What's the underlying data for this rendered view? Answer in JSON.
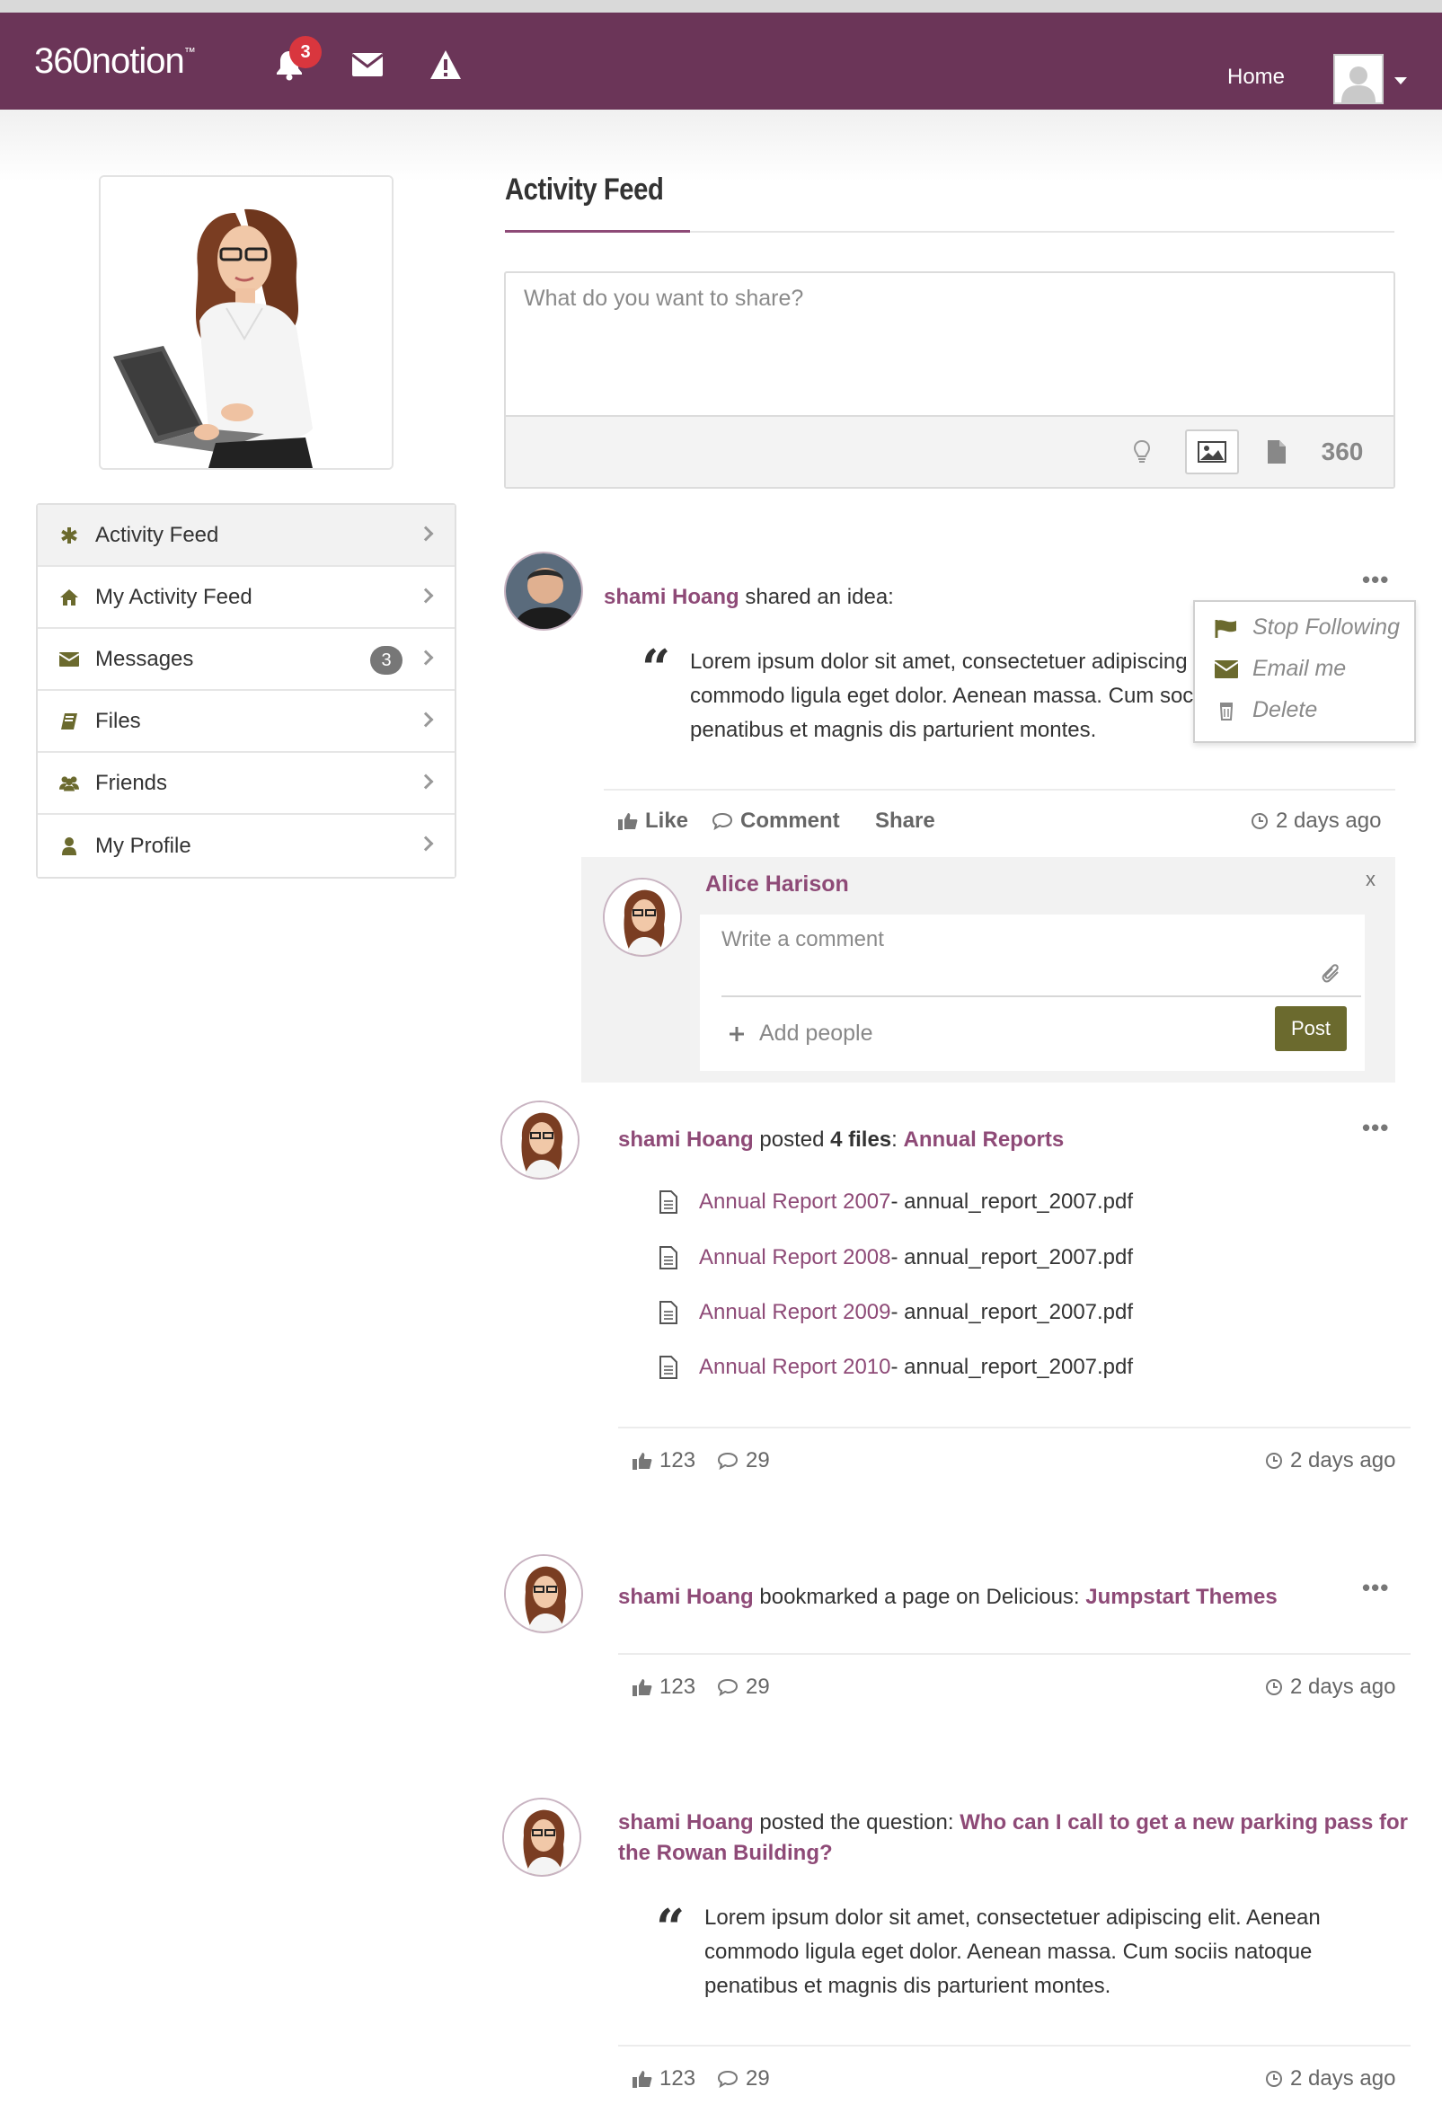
{
  "navbar": {
    "logo_text": "360notion",
    "logo_tm": "™",
    "notification_count": "3",
    "home_label": "Home"
  },
  "sidebar": {
    "items": [
      {
        "label": "Activity Feed",
        "icon": "asterisk-icon"
      },
      {
        "label": "My Activity Feed",
        "icon": "home-icon"
      },
      {
        "label": "Messages",
        "icon": "envelope-icon",
        "count": "3"
      },
      {
        "label": "Files",
        "icon": "book-icon"
      },
      {
        "label": "Friends",
        "icon": "users-icon"
      },
      {
        "label": "My Profile",
        "icon": "user-icon"
      }
    ]
  },
  "main": {
    "title": "Activity Feed",
    "share": {
      "placeholder": "What do you want to share?",
      "tool_360": "360"
    }
  },
  "posts": [
    {
      "author": "shami Hoang",
      "action": " shared an idea:",
      "quote": "Lorem ipsum dolor sit amet, consectetuer adipiscing elit. Aenean commodo ligula eget dolor. Aenean massa. Cum sociis natoque penatibus et magnis dis parturient montes.",
      "quote_visible_lines": [
        "Lorem ipsum dolor sit amet, consectetuer adipiscing",
        "commodo ligula eget dolor. Aenean massa. Cum soc",
        "penatibus et magnis dis parturient montes."
      ],
      "like_label": "Like",
      "comment_label": "Comment",
      "share_label": "Share",
      "time": "2 days ago"
    },
    {
      "author": "shami Hoang",
      "action": " posted ",
      "files_count": "4 files",
      "colon": ": ",
      "link": "Annual Reports",
      "files": [
        {
          "title": "Annual Report 2007",
          "filename": " - annual_report_2007.pdf"
        },
        {
          "title": "Annual Report 2008",
          "filename": " - annual_report_2007.pdf"
        },
        {
          "title": "Annual Report 2009",
          "filename": " - annual_report_2007.pdf"
        },
        {
          "title": "Annual Report 2010",
          "filename": " - annual_report_2007.pdf"
        }
      ],
      "likes": "123",
      "comments": "29",
      "time": "2 days ago"
    },
    {
      "author": "shami Hoang",
      "action": " bookmarked a page on Delicious: ",
      "link": "Jumpstart Themes",
      "likes": "123",
      "comments": "29",
      "time": "2 days ago"
    },
    {
      "author": "shami Hoang",
      "action": " posted the question: ",
      "link_line1": "Who can I call to get a new parking pass for",
      "link_line2": "the Rowan Building?",
      "quote_lines": [
        "Lorem ipsum dolor sit amet, consectetuer adipiscing elit. Aenean",
        "commodo ligula eget dolor. Aenean massa. Cum sociis natoque",
        "penatibus et magnis dis parturient montes."
      ],
      "likes": "123",
      "comments": "29",
      "time": "2 days ago"
    }
  ],
  "dropdown": {
    "items": [
      {
        "label": "Stop Following",
        "icon": "flag-icon"
      },
      {
        "label": "Email me",
        "icon": "envelope-icon"
      },
      {
        "label": "Delete",
        "icon": "trash-icon"
      }
    ]
  },
  "comment": {
    "name": "Alice Harison",
    "close": "x",
    "placeholder": "Write a comment",
    "add_people": "Add people",
    "post_label": "Post"
  },
  "colors": {
    "brand": "#6b3558",
    "link": "#8e4a77",
    "post_button": "#6b6a2e",
    "badge": "#d9363e"
  }
}
